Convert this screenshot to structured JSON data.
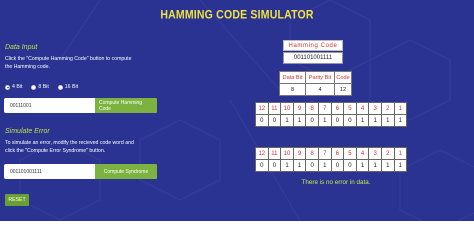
{
  "app": {
    "title": "HAMMING CODE SIMULATOR"
  },
  "data_input": {
    "heading": "Data Input",
    "help": "Click the \"Compute Hamming Code\" button to compute the Hamming code.",
    "options": [
      {
        "label": "4 Bit",
        "selected": true
      },
      {
        "label": "8 Bit",
        "selected": false
      },
      {
        "label": "16 Bit",
        "selected": false
      }
    ],
    "value": "00111001",
    "button_label": "Compute Hamming Code"
  },
  "simulate_error": {
    "heading": "Simulate Error",
    "help": "To simulate an error, modify the recieved code word and click the \"Compute Error Syndrome\" button.",
    "value": "001101001111",
    "button_label": "Compute Syndrome"
  },
  "reset_label": "RESET",
  "hamming_code": {
    "label": "Hamming Code",
    "value": "001101001111"
  },
  "summary_table": {
    "headers": [
      "Data Bit",
      "Parity Bit",
      "Code"
    ],
    "values": [
      "8",
      "4",
      "12"
    ]
  },
  "sent_code": {
    "positions": [
      "12",
      "11",
      "10",
      "9",
      "8",
      "7",
      "6",
      "5",
      "4",
      "3",
      "2",
      "1"
    ],
    "bits": [
      "0",
      "0",
      "1",
      "1",
      "0",
      "1",
      "0",
      "0",
      "1",
      "1",
      "1",
      "1"
    ]
  },
  "received_code": {
    "positions": [
      "12",
      "11",
      "10",
      "9",
      "8",
      "7",
      "6",
      "5",
      "4",
      "3",
      "2",
      "1"
    ],
    "bits": [
      "0",
      "0",
      "1",
      "1",
      "0",
      "1",
      "0",
      "0",
      "1",
      "1",
      "1",
      "1"
    ]
  },
  "result_message": "There is no error in data.",
  "colors": {
    "background": "#2a3391",
    "title": "#f3e33f",
    "section_heading": "#b9e046",
    "button": "#7cb340",
    "position_text": "#d23030",
    "result": "#c6ec45"
  }
}
